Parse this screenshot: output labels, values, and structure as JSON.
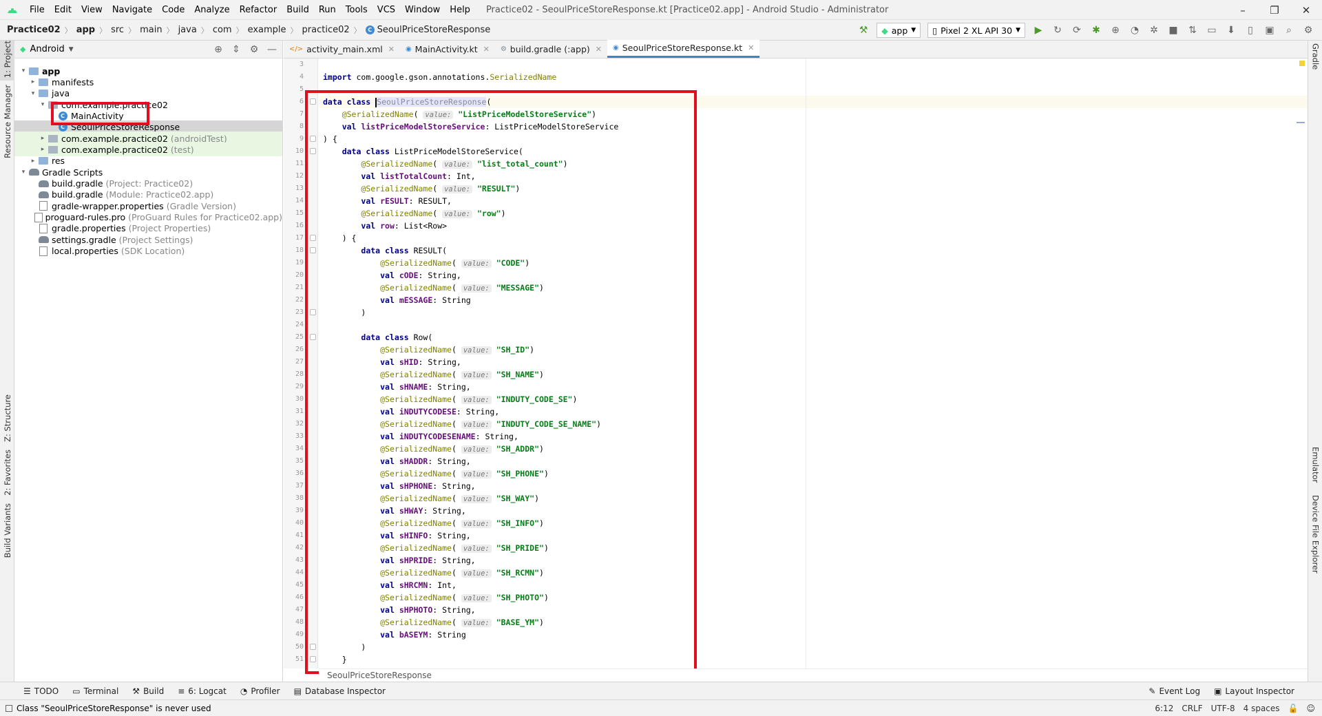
{
  "menubar": {
    "items": [
      "File",
      "Edit",
      "View",
      "Navigate",
      "Code",
      "Analyze",
      "Refactor",
      "Build",
      "Run",
      "Tools",
      "VCS",
      "Window",
      "Help"
    ],
    "window_title": "Practice02 - SeoulPriceStoreResponse.kt [Practice02.app] - Android Studio - Administrator"
  },
  "breadcrumb": [
    "Practice02",
    "app",
    "src",
    "main",
    "java",
    "com",
    "example",
    "practice02",
    "SeoulPriceStoreResponse"
  ],
  "toolbar": {
    "run_config": "app",
    "device": "Pixel 2 XL API 30"
  },
  "left_tool_tabs": [
    "1: Project",
    "Resource Manager",
    "Z: Structure",
    "2: Favorites",
    "Build Variants"
  ],
  "right_tool_tabs": [
    "Gradle",
    "Emulator",
    "Device File Explorer"
  ],
  "project_panel": {
    "view_mode": "Android",
    "tree": [
      {
        "label": "app",
        "muted": "",
        "indent": 0,
        "arrow": "▾",
        "icon": "folder",
        "bold": true
      },
      {
        "label": "manifests",
        "muted": "",
        "indent": 1,
        "arrow": "▸",
        "icon": "folder"
      },
      {
        "label": "java",
        "muted": "",
        "indent": 1,
        "arrow": "▾",
        "icon": "folder"
      },
      {
        "label": "com.example.practice02",
        "muted": "",
        "indent": 2,
        "arrow": "▾",
        "icon": "package"
      },
      {
        "label": "MainActivity",
        "muted": "",
        "indent": 3,
        "arrow": "",
        "icon": "kotlin"
      },
      {
        "label": "SeoulPriceStoreResponse",
        "muted": "",
        "indent": 3,
        "arrow": "",
        "icon": "kotlin"
      },
      {
        "label": "com.example.practice02",
        "muted": "(androidTest)",
        "indent": 2,
        "arrow": "▸",
        "icon": "package"
      },
      {
        "label": "com.example.practice02",
        "muted": "(test)",
        "indent": 2,
        "arrow": "▸",
        "icon": "package"
      },
      {
        "label": "res",
        "muted": "",
        "indent": 1,
        "arrow": "▸",
        "icon": "folder"
      },
      {
        "label": "Gradle Scripts",
        "muted": "",
        "indent": 0,
        "arrow": "▾",
        "icon": "gradle"
      },
      {
        "label": "build.gradle",
        "muted": "(Project: Practice02)",
        "indent": 1,
        "arrow": "",
        "icon": "gradle"
      },
      {
        "label": "build.gradle",
        "muted": "(Module: Practice02.app)",
        "indent": 1,
        "arrow": "",
        "icon": "gradle"
      },
      {
        "label": "gradle-wrapper.properties",
        "muted": "(Gradle Version)",
        "indent": 1,
        "arrow": "",
        "icon": "file"
      },
      {
        "label": "proguard-rules.pro",
        "muted": "(ProGuard Rules for Practice02.app)",
        "indent": 1,
        "arrow": "",
        "icon": "file"
      },
      {
        "label": "gradle.properties",
        "muted": "(Project Properties)",
        "indent": 1,
        "arrow": "",
        "icon": "file"
      },
      {
        "label": "settings.gradle",
        "muted": "(Project Settings)",
        "indent": 1,
        "arrow": "",
        "icon": "gradle"
      },
      {
        "label": "local.properties",
        "muted": "(SDK Location)",
        "indent": 1,
        "arrow": "",
        "icon": "file"
      }
    ]
  },
  "editor_tabs": [
    {
      "label": "activity_main.xml",
      "active": false
    },
    {
      "label": "MainActivity.kt",
      "active": false
    },
    {
      "label": "build.gradle (:app)",
      "active": false
    },
    {
      "label": "SeoulPriceStoreResponse.kt",
      "active": true
    }
  ],
  "code": {
    "first_line": 3,
    "lines": [
      "",
      "import com.google.gson.annotations.SerializedName",
      "",
      "data class SeoulPriceStoreResponse(",
      "    @SerializedName(value: \"ListPriceModelStoreService\")",
      "    val listPriceModelStoreService: ListPriceModelStoreService",
      ") {",
      "    data class ListPriceModelStoreService(",
      "        @SerializedName(value: \"list_total_count\")",
      "        val listTotalCount: Int,",
      "        @SerializedName(value: \"RESULT\")",
      "        val rESULT: RESULT,",
      "        @SerializedName(value: \"row\")",
      "        val row: List<Row>",
      "    ) {",
      "        data class RESULT(",
      "            @SerializedName(value: \"CODE\")",
      "            val cODE: String,",
      "            @SerializedName(value: \"MESSAGE\")",
      "            val mESSAGE: String",
      "        )",
      "",
      "        data class Row(",
      "            @SerializedName(value: \"SH_ID\")",
      "            val sHID: String,",
      "            @SerializedName(value: \"SH_NAME\")",
      "            val sHNAME: String,",
      "            @SerializedName(value: \"INDUTY_CODE_SE\")",
      "            val iNDUTYCODESE: String,",
      "            @SerializedName(value: \"INDUTY_CODE_SE_NAME\")",
      "            val iNDUTYCODESENAME: String,",
      "            @SerializedName(value: \"SH_ADDR\")",
      "            val sHADDR: String,",
      "            @SerializedName(value: \"SH_PHONE\")",
      "            val sHPHONE: String,",
      "            @SerializedName(value: \"SH_WAY\")",
      "            val sHWAY: String,",
      "            @SerializedName(value: \"SH_INFO\")",
      "            val sHINFO: String,",
      "            @SerializedName(value: \"SH_PRIDE\")",
      "            val sHPRIDE: String,",
      "            @SerializedName(value: \"SH_RCMN\")",
      "            val sHRCMN: Int,",
      "            @SerializedName(value: \"SH_PHOTO\")",
      "            val sHPHOTO: String,",
      "            @SerializedName(value: \"BASE_YM\")",
      "            val bASEYM: String",
      "        )",
      "    }"
    ],
    "current_line": 6
  },
  "editor_breadcrumb": "SeoulPriceStoreResponse",
  "tool_windows_left": [
    {
      "label": "TODO",
      "icon": "list-icon"
    },
    {
      "label": "Terminal",
      "icon": "terminal-icon"
    },
    {
      "label": "Build",
      "icon": "hammer-icon"
    },
    {
      "label": "6: Logcat",
      "icon": "logcat-icon"
    },
    {
      "label": "Profiler",
      "icon": "profiler-icon"
    },
    {
      "label": "Database Inspector",
      "icon": "database-icon"
    }
  ],
  "tool_windows_right": [
    {
      "label": "Event Log",
      "icon": "event-log-icon"
    },
    {
      "label": "Layout Inspector",
      "icon": "layout-inspector-icon"
    }
  ],
  "status": {
    "message": "Class \"SeoulPriceStoreResponse\" is never used",
    "position": "6:12",
    "line_separator": "CRLF",
    "encoding": "UTF-8",
    "indent": "4 spaces"
  }
}
